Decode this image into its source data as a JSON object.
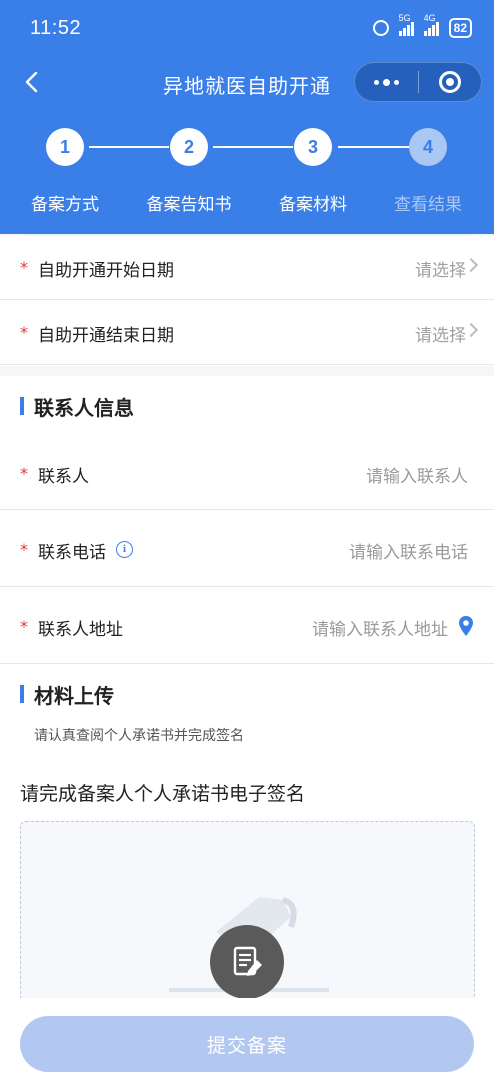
{
  "status_bar": {
    "time": "11:52",
    "net1": "5G",
    "net2": "4G",
    "battery": "82"
  },
  "nav": {
    "title": "异地就医自助开通"
  },
  "steps": [
    {
      "number": "1",
      "label": "备案方式",
      "state": "done"
    },
    {
      "number": "2",
      "label": "备案告知书",
      "state": "done"
    },
    {
      "number": "3",
      "label": "备案材料",
      "state": "current"
    },
    {
      "number": "4",
      "label": "查看结果",
      "state": "pending"
    }
  ],
  "date_fields": [
    {
      "label": "自助开通开始日期",
      "placeholder": "请选择"
    },
    {
      "label": "自助开通结束日期",
      "placeholder": "请选择"
    }
  ],
  "contact_section": {
    "title": "联系人信息",
    "fields": [
      {
        "label": "联系人",
        "placeholder": "请输入联系人"
      },
      {
        "label": "联系电话",
        "placeholder": "请输入联系电话"
      },
      {
        "label": "联系人地址",
        "placeholder": "请输入联系人地址"
      }
    ]
  },
  "upload_section": {
    "title": "材料上传",
    "hint": "请认真查阅个人承诺书并完成签名",
    "sign_title": "请完成备案人个人承诺书电子签名"
  },
  "submit": {
    "label": "提交备案"
  },
  "colors": {
    "primary": "#3a7ee8",
    "required": "#e4393c",
    "submit_disabled": "#b3c8f1"
  }
}
